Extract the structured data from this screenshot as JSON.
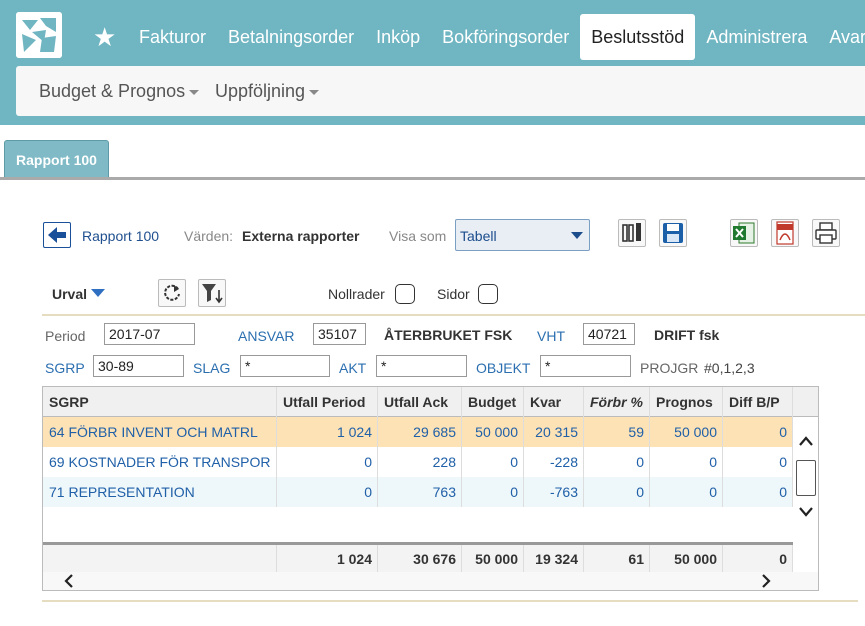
{
  "nav": {
    "items": [
      "Fakturor",
      "Betalningsorder",
      "Inköp",
      "Bokföringsorder",
      "Beslutsstöd",
      "Administrera",
      "Avar"
    ],
    "active_index": 4,
    "sub_items": [
      "Budget & Prognos",
      "Uppföljning"
    ]
  },
  "tab": {
    "label": "Rapport 100"
  },
  "toolbar": {
    "report_name": "Rapport 100",
    "varden_label": "Värden:",
    "varden_value": "Externa rapporter",
    "visa_som_label": "Visa som",
    "visa_som_value": "Tabell"
  },
  "urval": {
    "label": "Urval",
    "nollrader_label": "Nollrader",
    "sidor_label": "Sidor"
  },
  "filters": {
    "period_label": "Period",
    "period_value": "2017-07",
    "ansvar_label": "ANSVAR",
    "ansvar_value": "35107",
    "ansvar_name": "ÅTERBRUKET FSK",
    "vht_label": "VHT",
    "vht_value": "40721",
    "vht_name": "DRIFT fsk",
    "sgrp_label": "SGRP",
    "sgrp_value": "30-89",
    "slag_label": "SLAG",
    "slag_value": "*",
    "akt_label": "AKT",
    "akt_value": "*",
    "objekt_label": "OBJEKT",
    "objekt_value": "*",
    "projgr_label": "PROJGR",
    "projgr_value": "#0,1,2,3"
  },
  "table": {
    "columns": [
      "SGRP",
      "Utfall Period",
      "Utfall Ack",
      "Budget",
      "Kvar",
      "Förbr %",
      "Prognos",
      "Diff B/P"
    ],
    "rows": [
      [
        "64 FÖRBR INVENT OCH MATRL",
        "1 024",
        "29 685",
        "50 000",
        "20 315",
        "59",
        "50 000",
        "0"
      ],
      [
        "69 KOSTNADER FÖR TRANSPOR",
        "0",
        "228",
        "0",
        "-228",
        "0",
        "0",
        "0"
      ],
      [
        "71 REPRESENTATION",
        "0",
        "763",
        "0",
        "-763",
        "0",
        "0",
        "0"
      ]
    ],
    "totals": [
      "",
      "1 024",
      "30 676",
      "50 000",
      "19 324",
      "61",
      "50 000",
      "0"
    ]
  },
  "colors": {
    "header_bg": "#6fb5c2",
    "selected_row": "#fde2b5",
    "link_blue": "#2060a8"
  }
}
